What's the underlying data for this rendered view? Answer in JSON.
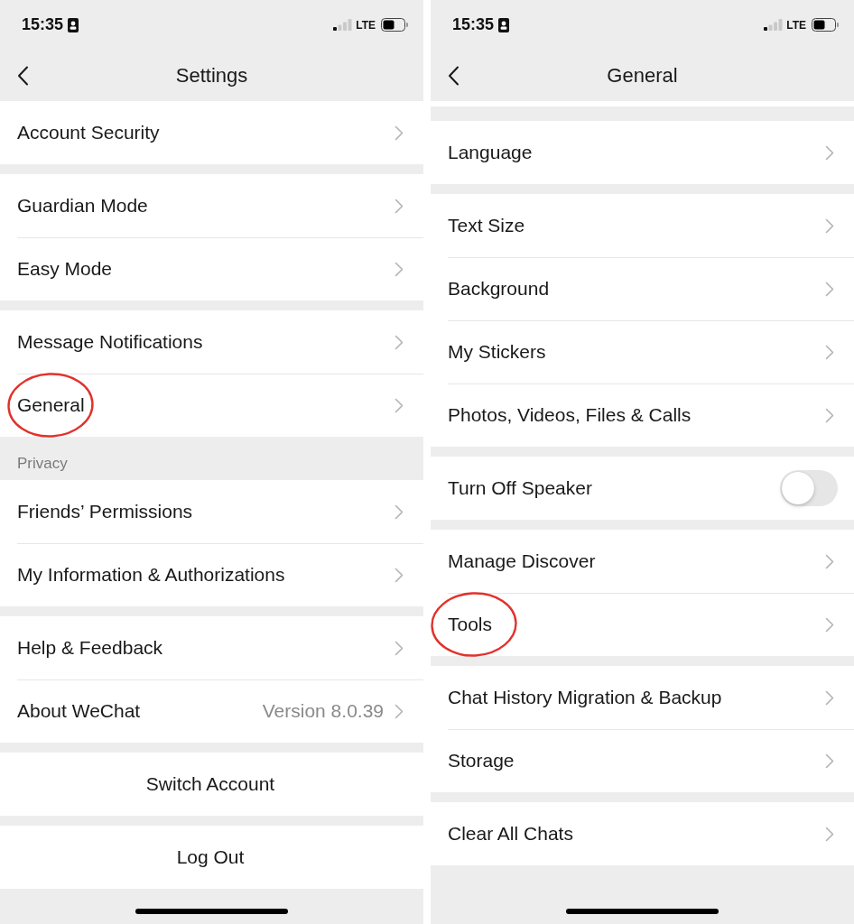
{
  "screens": [
    {
      "status_bar": {
        "time": "15:35",
        "network": "LTE"
      },
      "nav": {
        "title": "Settings"
      },
      "scrolled": false,
      "groups": [
        {
          "rows": [
            {
              "kind": "link",
              "label": "Account Security",
              "circled": false
            }
          ]
        },
        {
          "rows": [
            {
              "kind": "link",
              "label": "Guardian Mode",
              "circled": false
            },
            {
              "kind": "link",
              "label": "Easy Mode",
              "circled": false
            }
          ]
        },
        {
          "rows": [
            {
              "kind": "link",
              "label": "Message Notifications",
              "circled": false
            },
            {
              "kind": "link",
              "label": "General",
              "circled": true
            }
          ]
        },
        {
          "header": "Privacy",
          "rows": [
            {
              "kind": "link",
              "label": "Friends’ Permissions",
              "circled": false
            },
            {
              "kind": "link",
              "label": "My Information & Authorizations",
              "circled": false
            }
          ]
        },
        {
          "rows": [
            {
              "kind": "link",
              "label": "Help & Feedback",
              "circled": false
            },
            {
              "kind": "link",
              "label": "About WeChat",
              "value": "Version 8.0.39",
              "circled": false
            }
          ]
        },
        {
          "rows": [
            {
              "kind": "action",
              "label": "Switch Account",
              "circled": false
            }
          ]
        },
        {
          "rows": [
            {
              "kind": "action",
              "label": "Log Out",
              "circled": false
            }
          ]
        }
      ]
    },
    {
      "status_bar": {
        "time": "15:35",
        "network": "LTE"
      },
      "nav": {
        "title": "General"
      },
      "scrolled": true,
      "groups": [
        {
          "rows": [
            {
              "kind": "link",
              "label": "Language",
              "circled": false
            }
          ]
        },
        {
          "rows": [
            {
              "kind": "link",
              "label": "Text Size",
              "circled": false
            },
            {
              "kind": "link",
              "label": "Background",
              "circled": false
            },
            {
              "kind": "link",
              "label": "My Stickers",
              "circled": false
            },
            {
              "kind": "link",
              "label": "Photos, Videos, Files & Calls",
              "circled": false
            }
          ]
        },
        {
          "rows": [
            {
              "kind": "toggle",
              "label": "Turn Off Speaker",
              "on": false,
              "circled": false
            }
          ]
        },
        {
          "rows": [
            {
              "kind": "link",
              "label": "Manage Discover",
              "circled": false
            },
            {
              "kind": "link",
              "label": "Tools",
              "circled": true
            }
          ]
        },
        {
          "rows": [
            {
              "kind": "link",
              "label": "Chat History Migration & Backup",
              "circled": false
            },
            {
              "kind": "link",
              "label": "Storage",
              "circled": false
            }
          ]
        },
        {
          "rows": [
            {
              "kind": "link",
              "label": "Clear All Chats",
              "circled": false
            }
          ]
        }
      ]
    }
  ]
}
